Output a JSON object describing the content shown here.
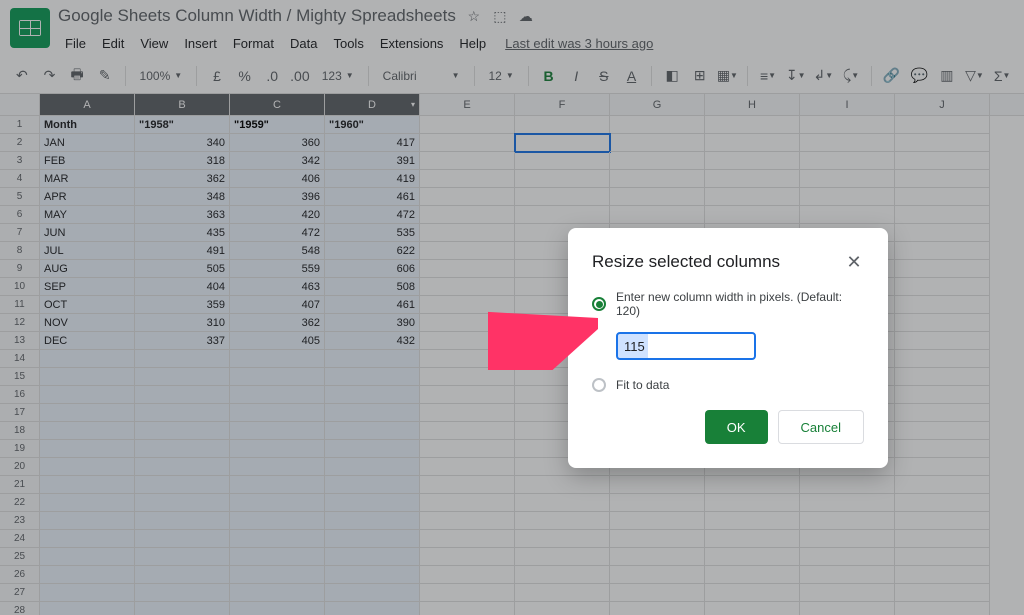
{
  "doc_title": "Google Sheets Column Width / Mighty Spreadsheets",
  "menus": [
    "File",
    "Edit",
    "View",
    "Insert",
    "Format",
    "Data",
    "Tools",
    "Extensions",
    "Help"
  ],
  "edit_info": "Last edit was 3 hours ago",
  "toolbar": {
    "zoom": "100%",
    "currency": "£",
    "percent": "%",
    "dec_dec": ".0",
    "inc_dec": ".00",
    "more_fmt": "123",
    "font": "Calibri",
    "size": "12"
  },
  "columns": [
    "A",
    "B",
    "C",
    "D",
    "E",
    "F",
    "G",
    "H",
    "I",
    "J"
  ],
  "selected_cols": [
    "A",
    "B",
    "C",
    "D"
  ],
  "header_row": {
    "A": "Month",
    "B": "\"1958\"",
    "C": "\"1959\"",
    "D": "\"1960\""
  },
  "data_rows": [
    {
      "A": "JAN",
      "B": "340",
      "C": "360",
      "D": "417"
    },
    {
      "A": "FEB",
      "B": "318",
      "C": "342",
      "D": "391"
    },
    {
      "A": "MAR",
      "B": "362",
      "C": "406",
      "D": "419"
    },
    {
      "A": "APR",
      "B": "348",
      "C": "396",
      "D": "461"
    },
    {
      "A": "MAY",
      "B": "363",
      "C": "420",
      "D": "472"
    },
    {
      "A": "JUN",
      "B": "435",
      "C": "472",
      "D": "535"
    },
    {
      "A": "JUL",
      "B": "491",
      "C": "548",
      "D": "622"
    },
    {
      "A": "AUG",
      "B": "505",
      "C": "559",
      "D": "606"
    },
    {
      "A": "SEP",
      "B": "404",
      "C": "463",
      "D": "508"
    },
    {
      "A": "OCT",
      "B": "359",
      "C": "407",
      "D": "461"
    },
    {
      "A": "NOV",
      "B": "310",
      "C": "362",
      "D": "390"
    },
    {
      "A": "DEC",
      "B": "337",
      "C": "405",
      "D": "432"
    }
  ],
  "total_rows": 28,
  "dialog": {
    "title": "Resize selected columns",
    "option_pixels": "Enter new column width in pixels. (Default: 120)",
    "option_fit": "Fit to data",
    "width_value": "115",
    "ok": "OK",
    "cancel": "Cancel"
  }
}
